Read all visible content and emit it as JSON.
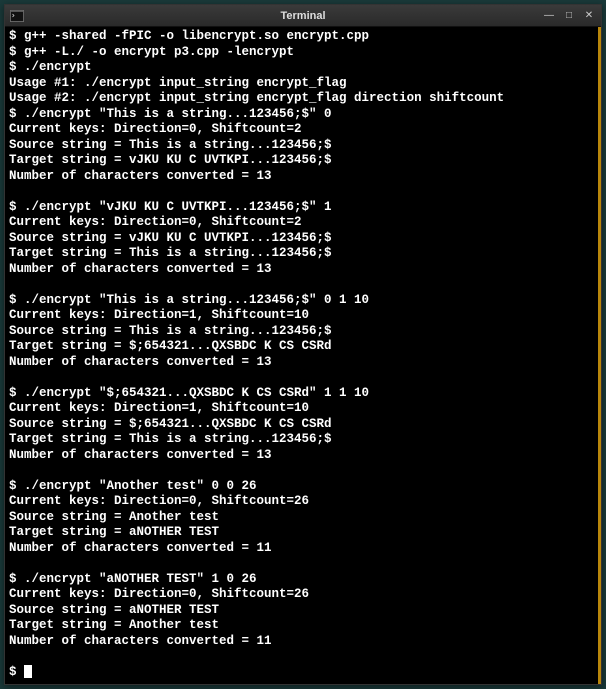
{
  "window": {
    "title": "Terminal"
  },
  "lines": [
    "$ g++ -shared -fPIC -o libencrypt.so encrypt.cpp",
    "$ g++ -L./ -o encrypt p3.cpp -lencrypt",
    "$ ./encrypt",
    "Usage #1: ./encrypt input_string encrypt_flag",
    "Usage #2: ./encrypt input_string encrypt_flag direction shiftcount",
    "$ ./encrypt \"This is a string...123456;$\" 0",
    "Current keys: Direction=0, Shiftcount=2",
    "Source string = This is a string...123456;$",
    "Target string = vJKU KU C UVTKPI...123456;$",
    "Number of characters converted = 13",
    "",
    "$ ./encrypt \"vJKU KU C UVTKPI...123456;$\" 1",
    "Current keys: Direction=0, Shiftcount=2",
    "Source string = vJKU KU C UVTKPI...123456;$",
    "Target string = This is a string...123456;$",
    "Number of characters converted = 13",
    "",
    "$ ./encrypt \"This is a string...123456;$\" 0 1 10",
    "Current keys: Direction=1, Shiftcount=10",
    "Source string = This is a string...123456;$",
    "Target string = $;654321...QXSBDC K CS CSRd",
    "Number of characters converted = 13",
    "",
    "$ ./encrypt \"$;654321...QXSBDC K CS CSRd\" 1 1 10",
    "Current keys: Direction=1, Shiftcount=10",
    "Source string = $;654321...QXSBDC K CS CSRd",
    "Target string = This is a string...123456;$",
    "Number of characters converted = 13",
    "",
    "$ ./encrypt \"Another test\" 0 0 26",
    "Current keys: Direction=0, Shiftcount=26",
    "Source string = Another test",
    "Target string = aNOTHER TEST",
    "Number of characters converted = 11",
    "",
    "$ ./encrypt \"aNOTHER TEST\" 1 0 26",
    "Current keys: Direction=0, Shiftcount=26",
    "Source string = aNOTHER TEST",
    "Target string = Another test",
    "Number of characters converted = 11",
    ""
  ],
  "prompt": "$ "
}
